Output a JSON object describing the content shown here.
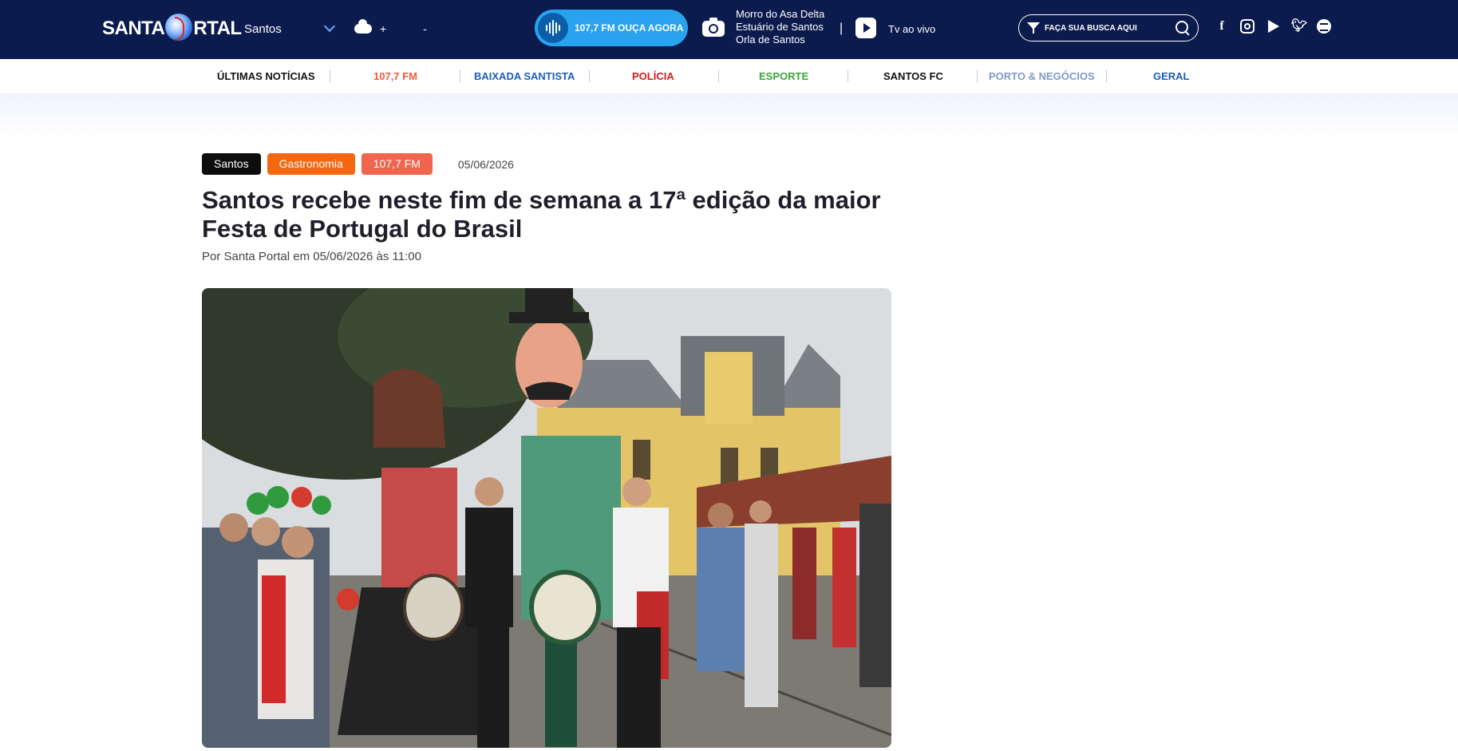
{
  "header": {
    "logo_text_1": "SANTA",
    "logo_text_2": "RTAL",
    "city": "Santos",
    "weather_plus": "+",
    "weather_minus": "-",
    "radio_label": "107,7 FM OUÇA AGORA",
    "cameras": [
      "Morro do Asa Delta",
      "Estuário de Santos",
      "Orla de Santos"
    ],
    "separator": "|",
    "tv_label": "Tv ao vivo",
    "search_placeholder": "FAÇA SUA BUSCA AQUI"
  },
  "nav": {
    "items": [
      {
        "label": "ÚLTIMAS NOTÍCIAS",
        "color": "#111111"
      },
      {
        "label": "107,7 FM",
        "color": "#f05a3c"
      },
      {
        "label": "BAIXADA SANTISTA",
        "color": "#1d5fb8"
      },
      {
        "label": "POLÍCIA",
        "color": "#d21c1c"
      },
      {
        "label": "ESPORTE",
        "color": "#3aa53a"
      },
      {
        "label": "SANTOS FC",
        "color": "#111111"
      },
      {
        "label": "PORTO & NEGÓCIOS",
        "color": "#7f9bc6"
      },
      {
        "label": "GERAL",
        "color": "#1d5fb8"
      }
    ]
  },
  "article": {
    "tags": [
      "Santos",
      "Gastronomia",
      "107,7 FM"
    ],
    "date": "05/06/2026",
    "title": "Santos recebe neste fim de semana a 17ª edição da maior Festa de Portugal do Brasil",
    "byline": "Por Santa Portal em 05/06/2026 às 11:00"
  },
  "icons": [
    "cloud-icon",
    "sound-wave-icon",
    "camera-icon",
    "tv-play-icon",
    "filter-icon",
    "search-icon",
    "facebook-icon",
    "instagram-icon",
    "youtube-icon",
    "twitter-icon",
    "spotify-icon"
  ]
}
